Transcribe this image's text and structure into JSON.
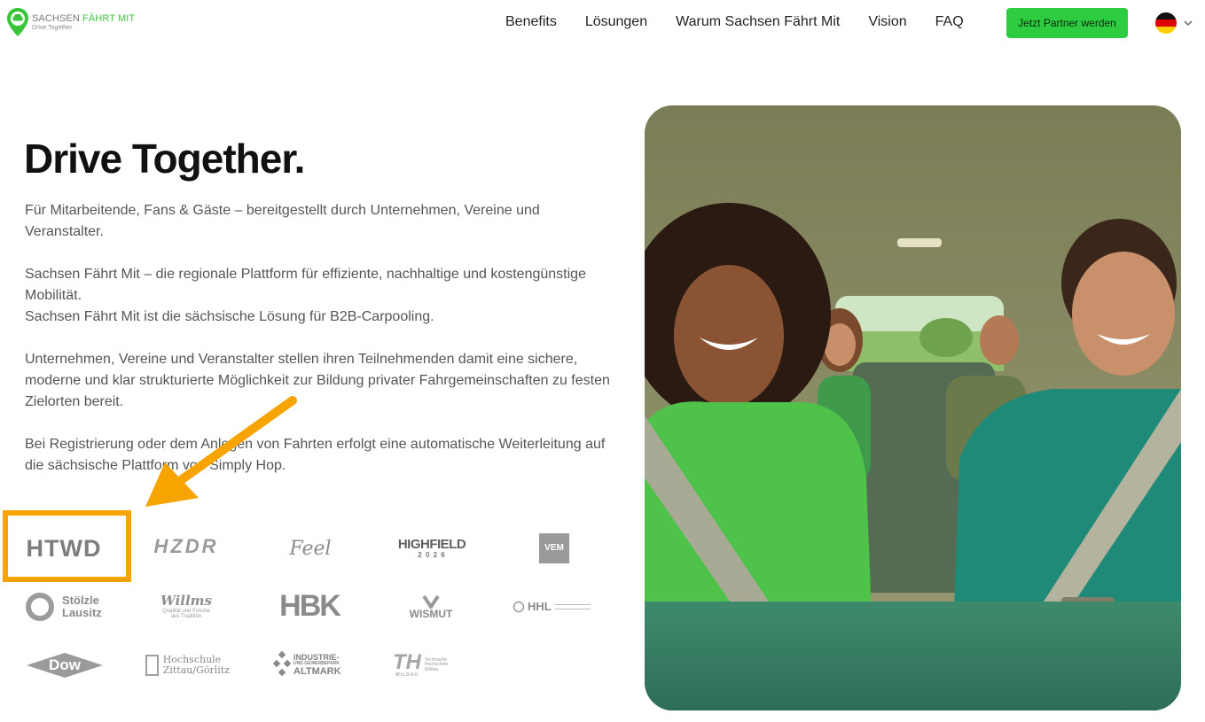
{
  "header": {
    "logo_title_part1": "SACHSEN",
    "logo_title_part2": "FÄHRT MIT",
    "logo_subtitle": "Drive Together",
    "nav": [
      "Benefits",
      "Lösungen",
      "Warum Sachsen Fährt Mit",
      "Vision",
      "FAQ"
    ],
    "cta_label": "Jetzt Partner werden",
    "language_flag": "germany-flag-icon"
  },
  "hero": {
    "title": "Drive Together.",
    "paragraphs": [
      "Für Mitarbeitende, Fans & Gäste – bereitgestellt durch Unternehmen, Vereine und Veranstalter.",
      "Sachsen Fährt Mit – die regionale Plattform für effiziente, nachhaltige und kostengünstige Mobilität.",
      "Sachsen Fährt Mit ist die sächsische Lösung für B2B-Carpooling.",
      "Unternehmen, Vereine und Veranstalter stellen ihren Teilnehmenden damit eine sichere, moderne und klar strukturierte Möglichkeit zur Bildung privater Fahrgemeinschaften zu festen Zielorten bereit.",
      "Bei Registrierung oder dem Anlegen von Fahrten erfolgt eine automatische Weiterleitung auf die sächsische Plattform von Simply Hop."
    ]
  },
  "partners": {
    "htwd": "HTWD",
    "hzdr": "HZDR",
    "feel": "Feel",
    "highfield": "HIGHFIELD",
    "highfield_year": "2 0 2 6",
    "vem": "VEM",
    "stoelzle_1": "Stölzle",
    "stoelzle_2": "Lausitz",
    "willms": "Willms",
    "willms_sub_1": "Qualität und Frische",
    "willms_sub_2": "aus Tradition",
    "hbk": "HBK",
    "wismut": "WISMUT",
    "hhl": "HHL",
    "dow": "Dow",
    "zittau_1": "Hochschule",
    "zittau_2": "Zittau/Görlitz",
    "altmark_1": "INDUSTRIE-",
    "altmark_2": "UND GEWERBEPARK",
    "altmark_3": "ALTMARK",
    "wildau": "TH",
    "wildau_text_1": "Technische",
    "wildau_text_2": "Hochschule",
    "wildau_text_3": "Wildau",
    "wildau_sub": "WILDAU"
  },
  "colors": {
    "brand_green": "#2ecc40",
    "highlight": "#f7a400",
    "text_muted": "#555555"
  }
}
